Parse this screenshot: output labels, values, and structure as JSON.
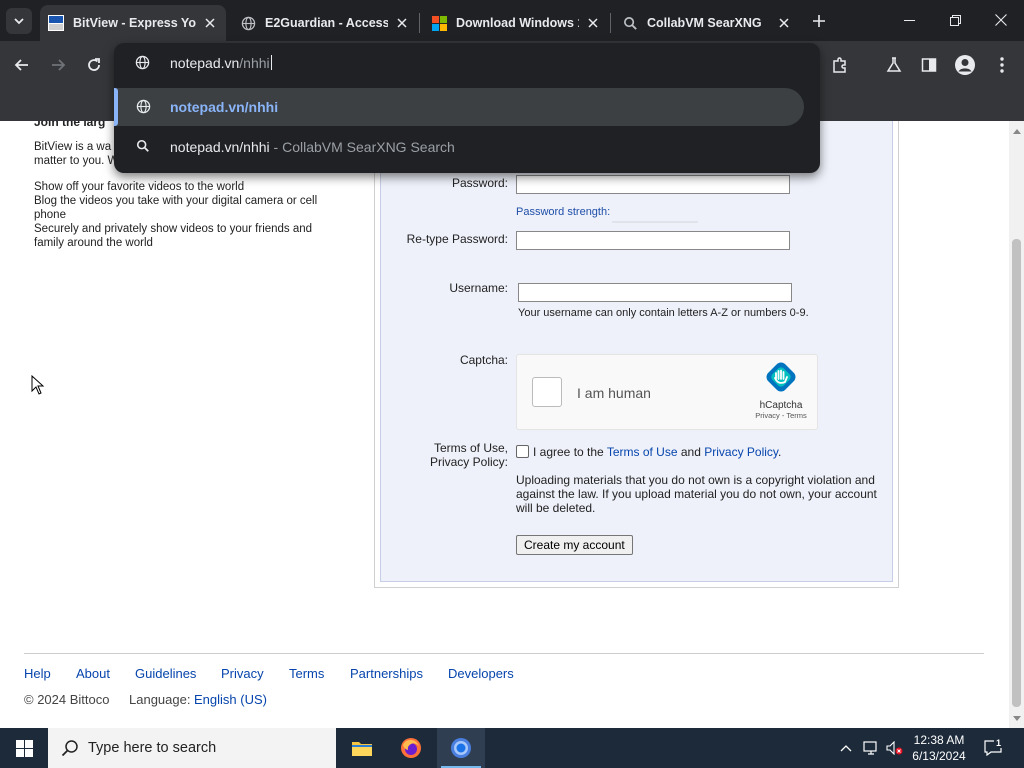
{
  "tabs": [
    {
      "title": "BitView - Express Yourself",
      "active": true
    },
    {
      "title": "E2Guardian - Access Denied",
      "active": false
    },
    {
      "title": "Download Windows 10",
      "active": false
    },
    {
      "title": "CollabVM SearXNG",
      "active": false
    }
  ],
  "omnibox": {
    "typed_host": "notepad.vn",
    "typed_path": "/nhhi",
    "suggestions": [
      {
        "text": "notepad.vn/nhhi",
        "sub": ""
      },
      {
        "text": "notepad.vn/nhhi",
        "sub": " - CollabVM SearXNG Search"
      }
    ]
  },
  "left": {
    "heading": "Join the larg",
    "intro": "BitView is a wa… matter to you. W",
    "intro_line1": "BitView is a wa",
    "intro_line2": "matter to you. W",
    "list": [
      "Show off your favorite videos to the world",
      "Blog the videos you take with your digital camera or cell phone",
      "Securely and privately show videos to your friends and family around the world"
    ]
  },
  "form": {
    "password_label": "Password:",
    "password_value": "",
    "strength_label": "Password strength:",
    "retype_label": "Re-type Password:",
    "retype_value": "",
    "username_label": "Username:",
    "username_value": "",
    "username_hint": "Your username can only contain letters A-Z or numbers 0-9.",
    "captcha_label": "Captcha:",
    "captcha_text": "I am human",
    "captcha_brand": "hCaptcha",
    "captcha_links": "Privacy - Terms",
    "terms_label_1": "Terms of Use,",
    "terms_label_2": "Privacy Policy:",
    "agree_prefix": "I agree to the ",
    "terms_link": "Terms of Use",
    "agree_and": " and ",
    "privacy_link": "Privacy Policy",
    "agree_suffix": ".",
    "warning": "Uploading materials that you do not own is a copyright violation and against the law. If you upload material you do not own, your account will be deleted.",
    "submit": "Create my account"
  },
  "footer": {
    "links": [
      "Help",
      "About",
      "Guidelines",
      "Privacy",
      "Terms",
      "Partnerships",
      "Developers"
    ],
    "copyright": "© 2024 Bittoco",
    "language_label": "Language:",
    "language_value": "English (US)"
  },
  "taskbar": {
    "search_placeholder": "Type here to search",
    "time": "12:38 AM",
    "date": "6/13/2024",
    "notification_count": "1"
  },
  "colors": {
    "chrome_dark": "#202124",
    "chrome_toolbar": "#35363a",
    "accent": "#8ab4f8",
    "link": "#0645ad",
    "form_bg": "#eef1fa"
  }
}
